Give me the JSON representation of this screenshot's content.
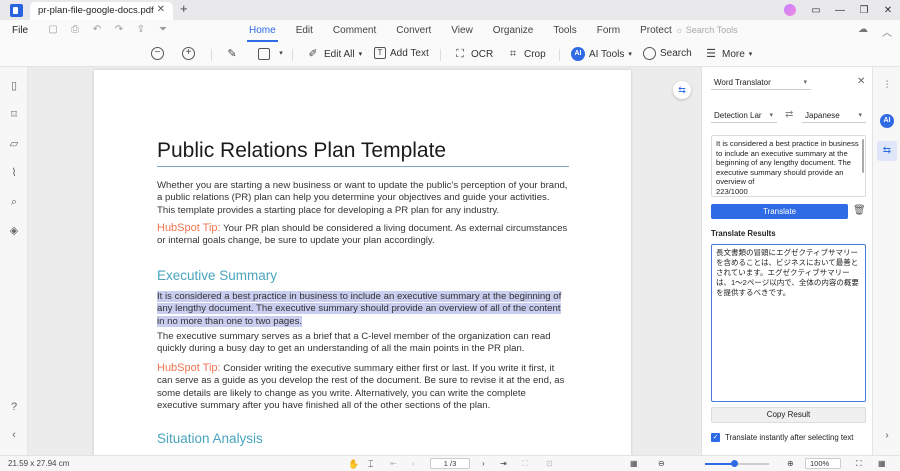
{
  "titlebar": {
    "tab_label": "pr-plan-file-google-docs.pdf",
    "close_glyph": "✕",
    "new_tab_glyph": "+",
    "window_controls": [
      "▭",
      "—",
      "❐",
      "✕"
    ]
  },
  "menubar": {
    "file_label": "File",
    "tabs": [
      "Home",
      "Edit",
      "Comment",
      "Convert",
      "View",
      "Organize",
      "Tools",
      "Form",
      "Protect"
    ],
    "active_tab": "Home",
    "search_tools_placeholder": "Search Tools"
  },
  "toolbar": {
    "edit_all_label": "Edit All",
    "add_text_label": "Add Text",
    "ocr_label": "OCR",
    "crop_label": "Crop",
    "ai_tools_label": "AI Tools",
    "search_label": "Search",
    "more_label": "More",
    "ai_badge": "AI"
  },
  "document": {
    "title": "Public Relations Plan Template",
    "intro": "Whether you are starting a new business or want to update the public’s perception of your brand, a public relations (PR) plan can help you determine your objectives and guide your activities. This template provides a starting place for developing a PR plan for any industry.",
    "tip1_label": "HubSpot Tip:",
    "tip1_text": " Your PR plan should be considered a living document. As external circumstances or internal goals change, be sure to update your plan accordingly.",
    "section1_heading": "Executive Summary",
    "section1_highlight": "It is considered a best practice in business to include an executive summary at the beginning of any lengthy document. The executive summary should provide an overview of all of the content in no more than one to two pages.",
    "section1_para2": "The executive summary serves as a brief that a C-level member of the organization can read quickly during a busy day to get an understanding of all the main points in the PR plan.",
    "tip2_label": "HubSpot Tip:",
    "tip2_text": " Consider writing the executive summary either first or last. If you write it first, it can serve as a guide as you develop the rest of the document. Be sure to revise it at the end, as some details are likely to change as you write. Alternatively, you can write the complete executive summary after you have finished all of the other sections of the plan.",
    "section2_heading": "Situation Analysis"
  },
  "translator": {
    "panel_title": "Word Translator",
    "source_lang": "Detection Lar",
    "target_lang": "Japanese",
    "source_text": "It is considered a best practice in business to include an executive summary at the beginning of any lengthy document. The executive summary should provide an overview of",
    "char_count": "223/1000",
    "translate_label": "Translate",
    "results_label": "Translate Results",
    "result_text": "長文書類の冒頭にエグゼクティブサマリーを含めることは、ビジネスにおいて最善とされています。エグゼクティブサマリーは、1～2ページ以内で、全体の内容の概要を提供するべきです。",
    "copy_label": "Copy Result",
    "instant_label": "Translate instantly after selecting text",
    "instant_checked": true
  },
  "statusbar": {
    "page_size": "21.59 x 27.94 cm",
    "page_indicator": "1 /3",
    "zoom": "100%",
    "zoom_fraction": 0.45
  },
  "colors": {
    "accent": "#2f6be4",
    "tip": "#f07451",
    "heading": "#4aa4bf",
    "highlight": "#c9cdf0"
  }
}
